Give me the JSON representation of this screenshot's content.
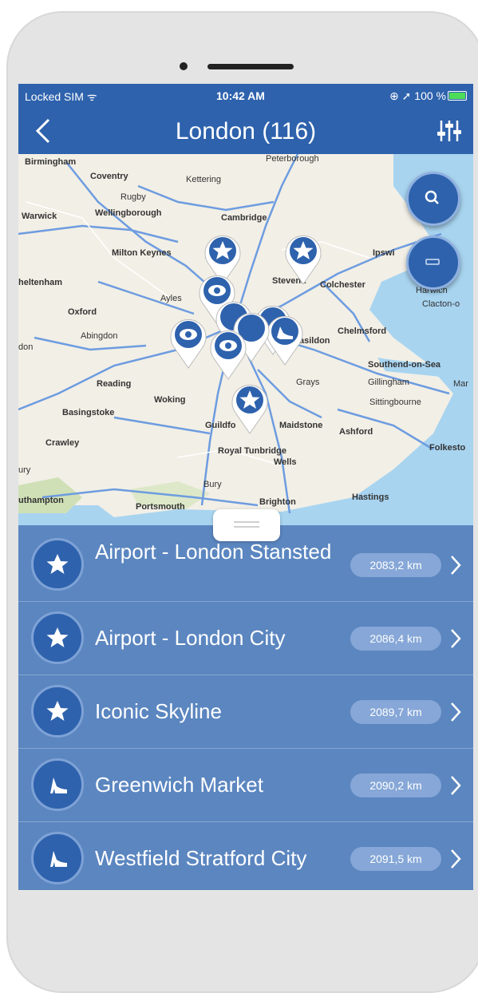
{
  "status_bar": {
    "carrier": "Locked SIM ᯤ",
    "time": "10:42 AM",
    "right": "⊕ ➚ 100 %"
  },
  "nav": {
    "title": "London (116)"
  },
  "map": {
    "cities": [
      {
        "name": "Birmingham",
        "bold": true
      },
      {
        "name": "Coventry",
        "bold": true
      },
      {
        "name": "Kettering",
        "bold": false
      },
      {
        "name": "Peterborough",
        "bold": false
      },
      {
        "name": "Rugby",
        "bold": false
      },
      {
        "name": "Warwick",
        "bold": true
      },
      {
        "name": "Wellingborough",
        "bold": true
      },
      {
        "name": "Cambridge",
        "bold": true
      },
      {
        "name": "Milton Keynes",
        "bold": true
      },
      {
        "name": "Ipswi",
        "bold": true
      },
      {
        "name": "heltenham",
        "bold": true
      },
      {
        "name": "Stevena",
        "bold": true
      },
      {
        "name": "Colchester",
        "bold": true
      },
      {
        "name": "Harwich",
        "bold": false
      },
      {
        "name": "Clacton-o",
        "bold": false
      },
      {
        "name": "Oxford",
        "bold": true
      },
      {
        "name": "Ayles",
        "bold": false
      },
      {
        "name": "Abingdon",
        "bold": false
      },
      {
        "name": "Chelmsford",
        "bold": true
      },
      {
        "name": "don",
        "bold": false
      },
      {
        "name": "asildon",
        "bold": true
      },
      {
        "name": "Southend-on-Sea",
        "bold": true
      },
      {
        "name": "Reading",
        "bold": true
      },
      {
        "name": "Grays",
        "bold": false
      },
      {
        "name": "Gillingham",
        "bold": false
      },
      {
        "name": "Mar",
        "bold": false
      },
      {
        "name": "Woking",
        "bold": true
      },
      {
        "name": "Basingstoke",
        "bold": true
      },
      {
        "name": "Sittingbourne",
        "bold": false
      },
      {
        "name": "Guildfo",
        "bold": true
      },
      {
        "name": "Maidstone",
        "bold": true
      },
      {
        "name": "Ashford",
        "bold": true
      },
      {
        "name": "Crawley",
        "bold": true
      },
      {
        "name": "Royal Tunbridge",
        "bold": true
      },
      {
        "name": "Wells",
        "bold": true
      },
      {
        "name": "Folkesto",
        "bold": true
      },
      {
        "name": "ury",
        "bold": false
      },
      {
        "name": "Bury",
        "bold": false
      },
      {
        "name": "uthampton",
        "bold": true
      },
      {
        "name": "Portsmouth",
        "bold": true
      },
      {
        "name": "Brighton",
        "bold": true
      },
      {
        "name": "Hastings",
        "bold": true
      }
    ]
  },
  "list": {
    "items": [
      {
        "title": "Airport - London Stansted",
        "distance": "2083,2 km",
        "icon": "star-icon"
      },
      {
        "title": "Airport - London City",
        "distance": "2086,4 km",
        "icon": "star-icon"
      },
      {
        "title": "Iconic Skyline",
        "distance": "2089,7 km",
        "icon": "star-icon"
      },
      {
        "title": "Greenwich Market",
        "distance": "2090,2 km",
        "icon": "shoe-icon"
      },
      {
        "title": "Westfield Stratford City",
        "distance": "2091,5 km",
        "icon": "shoe-icon"
      }
    ]
  },
  "colors": {
    "primary": "#2e62ad",
    "list_bg": "#5b86c0",
    "badge": "#86a7d7",
    "map_bg": "#f2efe6",
    "water": "#a8d4f0"
  }
}
